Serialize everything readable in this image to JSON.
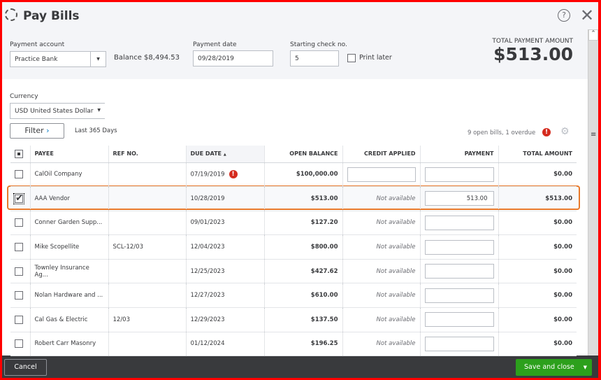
{
  "title": "Pay Bills",
  "payment_account": {
    "label": "Payment account",
    "value": "Practice Bank"
  },
  "balance": "Balance $8,494.53",
  "payment_date": {
    "label": "Payment date",
    "value": "09/28/2019"
  },
  "check_no": {
    "label": "Starting check no.",
    "value": "5"
  },
  "print_later": "Print later",
  "total": {
    "label": "TOTAL PAYMENT AMOUNT",
    "value": "$513.00"
  },
  "currency": {
    "label": "Currency",
    "value": "USD United States Dollar"
  },
  "filter": {
    "label": "Filter",
    "range": "Last 365 Days"
  },
  "summary": "9 open bills, 1 overdue",
  "columns": [
    "PAYEE",
    "REF NO.",
    "DUE DATE",
    "OPEN BALANCE",
    "CREDIT APPLIED",
    "PAYMENT",
    "TOTAL AMOUNT"
  ],
  "rows": [
    {
      "payee": "CalOil Company",
      "ref": "",
      "due": "07/19/2019",
      "overdue": true,
      "open": "$100,000.00",
      "credit": "",
      "payment": "",
      "total": "$0.00",
      "checked": false
    },
    {
      "payee": "AAA Vendor",
      "ref": "",
      "due": "10/28/2019",
      "open": "$513.00",
      "credit": "Not available",
      "payment": "513.00",
      "total": "$513.00",
      "checked": true
    },
    {
      "payee": "Conner Garden Supp...",
      "ref": "",
      "due": "09/01/2023",
      "open": "$127.20",
      "credit": "Not available",
      "payment": "",
      "total": "$0.00",
      "checked": false
    },
    {
      "payee": "Mike Scopellite",
      "ref": "SCL-12/03",
      "due": "12/04/2023",
      "open": "$800.00",
      "credit": "Not available",
      "payment": "",
      "total": "$0.00",
      "checked": false
    },
    {
      "payee": "Townley Insurance Ag...",
      "ref": "",
      "due": "12/25/2023",
      "open": "$427.62",
      "credit": "Not available",
      "payment": "",
      "total": "$0.00",
      "checked": false
    },
    {
      "payee": "Nolan Hardware and ...",
      "ref": "",
      "due": "12/27/2023",
      "open": "$610.00",
      "credit": "Not available",
      "payment": "",
      "total": "$0.00",
      "checked": false
    },
    {
      "payee": "Cal Gas & Electric",
      "ref": "12/03",
      "due": "12/29/2023",
      "open": "$137.50",
      "credit": "Not available",
      "payment": "",
      "total": "$0.00",
      "checked": false
    },
    {
      "payee": "Robert Carr Masonry",
      "ref": "",
      "due": "01/12/2024",
      "open": "$196.25",
      "credit": "Not available",
      "payment": "",
      "total": "$0.00",
      "checked": false
    }
  ],
  "footer": {
    "cancel": "Cancel",
    "save": "Save and close"
  },
  "colors": {
    "accent": "#2ca01c",
    "highlight": "#e8792b",
    "overdue": "#d52b1e"
  }
}
